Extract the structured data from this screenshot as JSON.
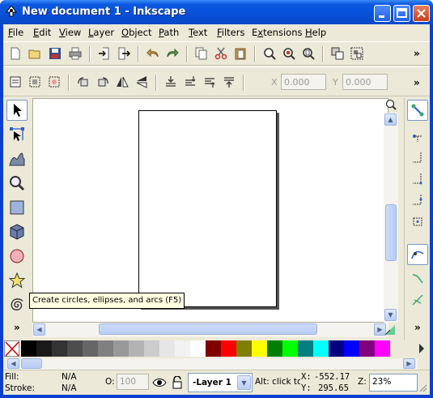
{
  "window": {
    "title": "New document 1 - Inkscape"
  },
  "menu": [
    {
      "label": "File",
      "u": "F",
      "rest": "ile"
    },
    {
      "label": "Edit",
      "u": "E",
      "rest": "dit"
    },
    {
      "label": "View",
      "u": "V",
      "rest": "iew"
    },
    {
      "label": "Layer",
      "u": "L",
      "rest": "ayer"
    },
    {
      "label": "Object",
      "u": "O",
      "rest": "bject"
    },
    {
      "label": "Path",
      "u": "P",
      "rest": "ath"
    },
    {
      "label": "Text",
      "u": "T",
      "rest": "ext"
    },
    {
      "label": "Filters",
      "u": "F",
      "rest": "ilters"
    },
    {
      "label": "Extensions",
      "u": "x",
      "pre": "E",
      "rest": "tensions"
    },
    {
      "label": "Help",
      "u": "H",
      "rest": "elp"
    }
  ],
  "command_toolbar": {
    "overflow": "»"
  },
  "controls_toolbar": {
    "x_label": "X",
    "x_value": "0.000",
    "y_label": "Y",
    "y_value": "0.000",
    "overflow": "»"
  },
  "toolbox": {
    "overflow": "»"
  },
  "tooltip": {
    "text": "Create circles, ellipses, and arcs (F5)"
  },
  "snap": {
    "overflow": "»"
  },
  "palette": {
    "colors": [
      "#000000",
      "#1a1a1a",
      "#333333",
      "#4d4d4d",
      "#666666",
      "#808080",
      "#999999",
      "#b3b3b3",
      "#cccccc",
      "#e6e6e6",
      "#f2f2f2",
      "#ffffff",
      "#800000",
      "#ff0000",
      "#808000",
      "#ffff00",
      "#008000",
      "#00ff00",
      "#008080",
      "#00ffff",
      "#000080",
      "#0000ff",
      "#800080",
      "#ff00ff"
    ]
  },
  "status": {
    "fill_label": "Fill:",
    "fill_value": "N/A",
    "stroke_label": "Stroke:",
    "stroke_value": "N/A",
    "opacity_label": "O:",
    "opacity_value": "100",
    "layer": "-Layer 1",
    "message": "Alt: click to",
    "x_label": "X:",
    "x_value": "-552.17",
    "y_label": "Y:",
    "y_value": "295.65",
    "zoom_label": "Z:",
    "zoom_value": "23%"
  }
}
